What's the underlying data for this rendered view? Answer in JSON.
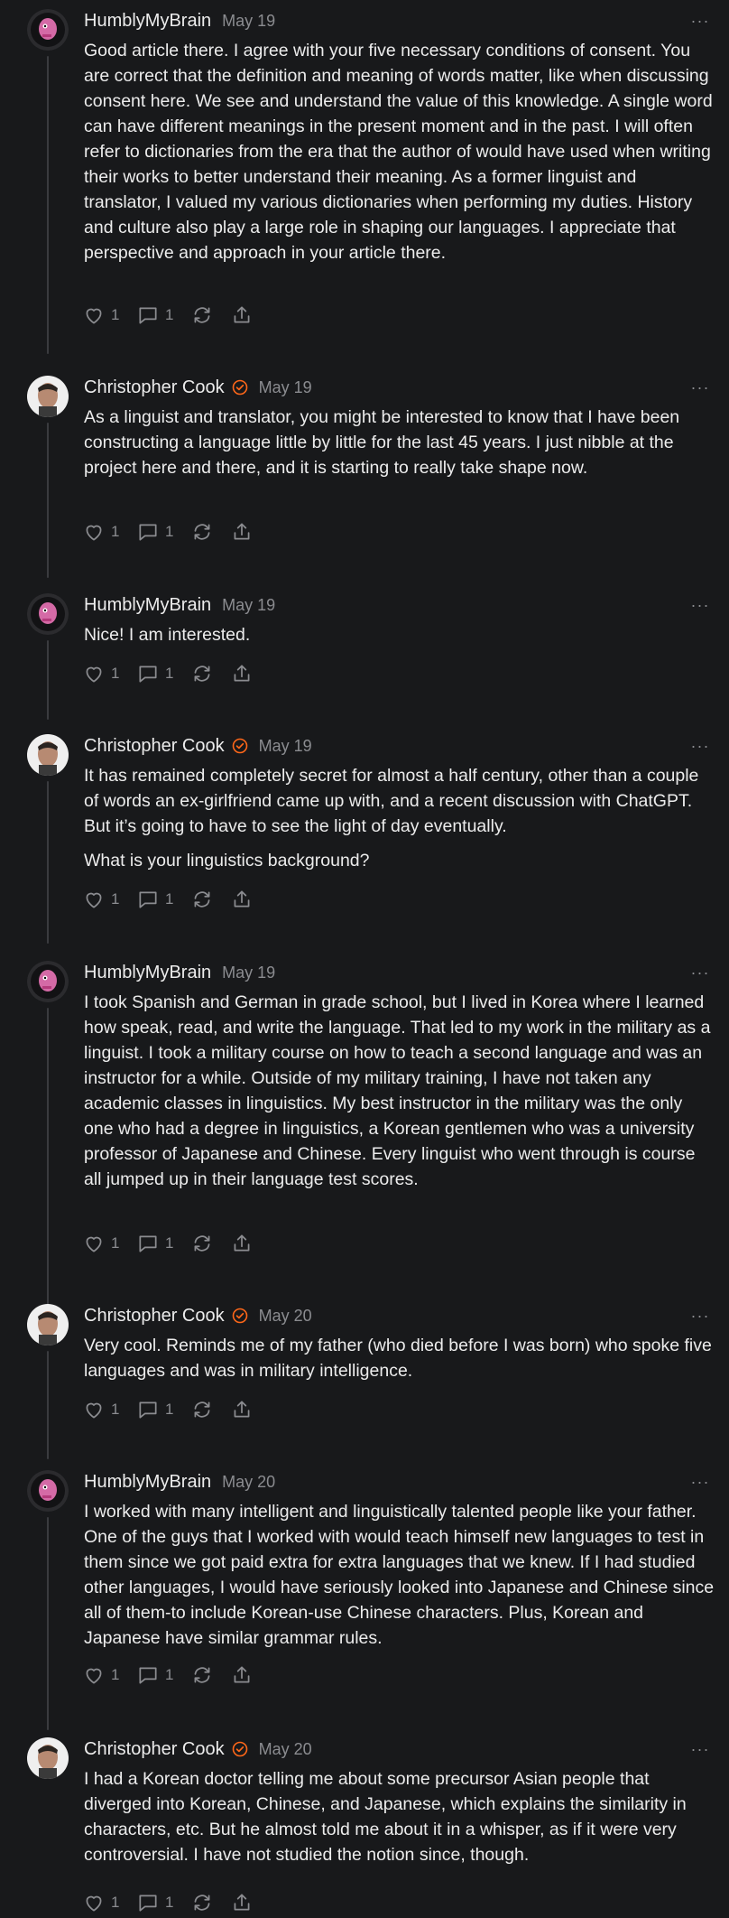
{
  "comments": [
    {
      "author": "HumblyMyBrain",
      "date": "May 19",
      "verified": false,
      "paragraphs": [
        "Good article there. I agree with your five necessary conditions of consent. You are correct that the definition and meaning of words matter, like when discussing consent here. We see and understand the value of this knowledge. A single word can have different meanings in the present moment and in the past. I will often refer to dictionaries from the era that the author of would have used when writing their works to better understand their meaning. As a former linguist and translator, I valued my various dictionaries when performing my duties. History and culture also play a large role in shaping our languages. I appreciate that perspective and approach in your article there."
      ],
      "likes": "1",
      "replies": "1"
    },
    {
      "author": "Christopher Cook",
      "date": "May 19",
      "verified": true,
      "paragraphs": [
        "As a linguist and translator, you might be interested to know that I have been constructing a language little by little for the last 45 years. I just nibble at the project here and there, and it is starting to really take shape now."
      ],
      "likes": "1",
      "replies": "1"
    },
    {
      "author": "HumblyMyBrain",
      "date": "May 19",
      "verified": false,
      "paragraphs": [
        "Nice! I am interested."
      ],
      "likes": "1",
      "replies": "1"
    },
    {
      "author": "Christopher Cook",
      "date": "May 19",
      "verified": true,
      "paragraphs": [
        "It has remained completely secret for almost a half century, other than a couple of words an ex-girlfriend came up with, and a recent discussion with ChatGPT. But it’s going to have to see the light of day eventually.",
        "What is your linguistics background?"
      ],
      "likes": "1",
      "replies": "1"
    },
    {
      "author": "HumblyMyBrain",
      "date": "May 19",
      "verified": false,
      "paragraphs": [
        "I took Spanish and German in grade school, but I lived in Korea where I learned how speak, read, and write the language. That led to my work in the military as a linguist. I took a military course on how to teach a second language and was an instructor for a while. Outside of my military training, I have not taken any academic classes in linguistics. My best instructor in the military was the only one who had a degree in linguistics, a Korean gentlemen who was a university professor of Japanese and Chinese. Every linguist who went through is course all jumped up in their language test scores."
      ],
      "likes": "1",
      "replies": "1"
    },
    {
      "author": "Christopher Cook",
      "date": "May 20",
      "verified": true,
      "paragraphs": [
        "Very cool. Reminds me of my father (who died before I was born) who spoke five languages and was in military intelligence."
      ],
      "likes": "1",
      "replies": "1"
    },
    {
      "author": "HumblyMyBrain",
      "date": "May 20",
      "verified": false,
      "paragraphs": [
        "I worked with many intelligent and linguistically talented people like your father. One of the guys that I worked with would teach himself new languages to test in them since we got paid extra for extra languages that we knew. If I had studied other languages, I would have seriously looked into Japanese and Chinese since all of them-to include Korean-use Chinese characters. Plus, Korean and Japanese have similar grammar rules."
      ],
      "likes": "1",
      "replies": "1"
    },
    {
      "author": "Christopher Cook",
      "date": "May 20",
      "verified": true,
      "paragraphs": [
        "I had a Korean doctor telling me about some precursor Asian people that diverged into Korean, Chinese, and Japanese, which explains the similarity in characters, etc. But he almost told me about it in a whisper, as if it were very controversial. I have not studied the notion since, though."
      ],
      "likes": "1",
      "replies": "1"
    }
  ],
  "more_label": "···",
  "colors": {
    "verified": "#ff6719",
    "muted": "#8b8c90",
    "text": "#ececec",
    "background": "#18191b"
  }
}
